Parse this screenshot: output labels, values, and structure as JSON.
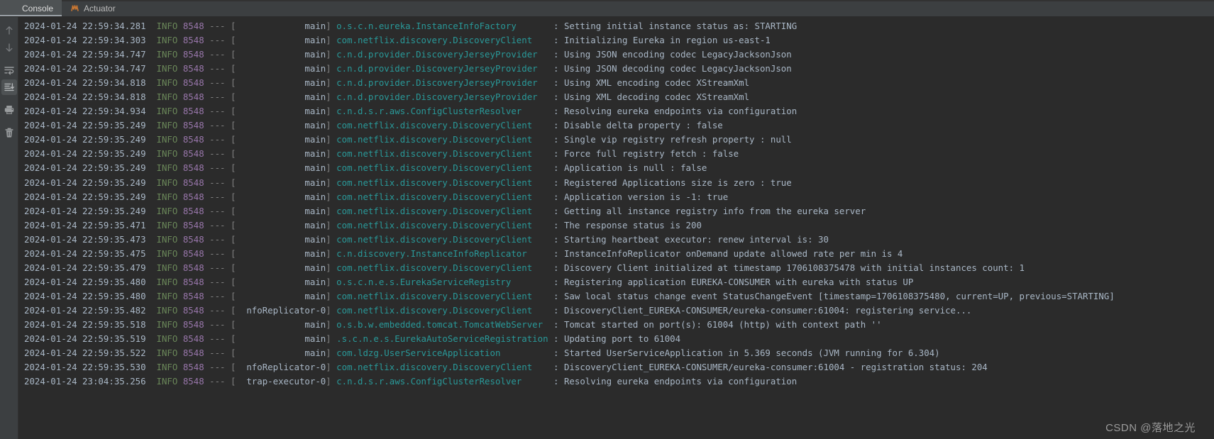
{
  "window": {
    "background_color": "#2b2b2b",
    "chrome_color": "#3c3f41"
  },
  "tabs": [
    {
      "id": "console",
      "label": "Console",
      "icon": "console-icon",
      "active": true
    },
    {
      "id": "actuator",
      "label": "Actuator",
      "icon": "actuator-icon",
      "active": false
    }
  ],
  "toolbar": {
    "buttons": [
      {
        "id": "up",
        "label": "Up",
        "icon": "arrow-up-icon",
        "selected": false
      },
      {
        "id": "down",
        "label": "Down",
        "icon": "arrow-down-icon",
        "selected": false
      },
      {
        "id": "soft-wrap",
        "label": "Soft-Wrap",
        "icon": "soft-wrap-icon",
        "selected": false
      },
      {
        "id": "scroll-end",
        "label": "Scroll to End",
        "icon": "scroll-to-end-icon",
        "selected": true
      },
      {
        "id": "print",
        "label": "Print",
        "icon": "print-icon",
        "selected": false
      },
      {
        "id": "clear-all",
        "label": "Clear All",
        "icon": "trash-icon",
        "selected": false
      }
    ]
  },
  "colors": {
    "timestamp": "#a9b7c6",
    "level": "#6a8759",
    "pid": "#9876aa",
    "separator": "#808080",
    "thread": "#a9b7c6",
    "logger": "#299999",
    "message": "#a9b7c6"
  },
  "console": {
    "lines": [
      {
        "time": "2024-01-24 22:59:34.281",
        "level": "INFO",
        "pid": "8548",
        "thread": "main",
        "logger": "o.s.c.n.eureka.InstanceInfoFactory",
        "message": "Setting initial instance status as: STARTING"
      },
      {
        "time": "2024-01-24 22:59:34.303",
        "level": "INFO",
        "pid": "8548",
        "thread": "main",
        "logger": "com.netflix.discovery.DiscoveryClient",
        "message": "Initializing Eureka in region us-east-1"
      },
      {
        "time": "2024-01-24 22:59:34.747",
        "level": "INFO",
        "pid": "8548",
        "thread": "main",
        "logger": "c.n.d.provider.DiscoveryJerseyProvider",
        "message": "Using JSON encoding codec LegacyJacksonJson"
      },
      {
        "time": "2024-01-24 22:59:34.747",
        "level": "INFO",
        "pid": "8548",
        "thread": "main",
        "logger": "c.n.d.provider.DiscoveryJerseyProvider",
        "message": "Using JSON decoding codec LegacyJacksonJson"
      },
      {
        "time": "2024-01-24 22:59:34.818",
        "level": "INFO",
        "pid": "8548",
        "thread": "main",
        "logger": "c.n.d.provider.DiscoveryJerseyProvider",
        "message": "Using XML encoding codec XStreamXml"
      },
      {
        "time": "2024-01-24 22:59:34.818",
        "level": "INFO",
        "pid": "8548",
        "thread": "main",
        "logger": "c.n.d.provider.DiscoveryJerseyProvider",
        "message": "Using XML decoding codec XStreamXml"
      },
      {
        "time": "2024-01-24 22:59:34.934",
        "level": "INFO",
        "pid": "8548",
        "thread": "main",
        "logger": "c.n.d.s.r.aws.ConfigClusterResolver",
        "message": "Resolving eureka endpoints via configuration"
      },
      {
        "time": "2024-01-24 22:59:35.249",
        "level": "INFO",
        "pid": "8548",
        "thread": "main",
        "logger": "com.netflix.discovery.DiscoveryClient",
        "message": "Disable delta property : false"
      },
      {
        "time": "2024-01-24 22:59:35.249",
        "level": "INFO",
        "pid": "8548",
        "thread": "main",
        "logger": "com.netflix.discovery.DiscoveryClient",
        "message": "Single vip registry refresh property : null"
      },
      {
        "time": "2024-01-24 22:59:35.249",
        "level": "INFO",
        "pid": "8548",
        "thread": "main",
        "logger": "com.netflix.discovery.DiscoveryClient",
        "message": "Force full registry fetch : false"
      },
      {
        "time": "2024-01-24 22:59:35.249",
        "level": "INFO",
        "pid": "8548",
        "thread": "main",
        "logger": "com.netflix.discovery.DiscoveryClient",
        "message": "Application is null : false"
      },
      {
        "time": "2024-01-24 22:59:35.249",
        "level": "INFO",
        "pid": "8548",
        "thread": "main",
        "logger": "com.netflix.discovery.DiscoveryClient",
        "message": "Registered Applications size is zero : true"
      },
      {
        "time": "2024-01-24 22:59:35.249",
        "level": "INFO",
        "pid": "8548",
        "thread": "main",
        "logger": "com.netflix.discovery.DiscoveryClient",
        "message": "Application version is -1: true"
      },
      {
        "time": "2024-01-24 22:59:35.249",
        "level": "INFO",
        "pid": "8548",
        "thread": "main",
        "logger": "com.netflix.discovery.DiscoveryClient",
        "message": "Getting all instance registry info from the eureka server"
      },
      {
        "time": "2024-01-24 22:59:35.471",
        "level": "INFO",
        "pid": "8548",
        "thread": "main",
        "logger": "com.netflix.discovery.DiscoveryClient",
        "message": "The response status is 200"
      },
      {
        "time": "2024-01-24 22:59:35.473",
        "level": "INFO",
        "pid": "8548",
        "thread": "main",
        "logger": "com.netflix.discovery.DiscoveryClient",
        "message": "Starting heartbeat executor: renew interval is: 30"
      },
      {
        "time": "2024-01-24 22:59:35.475",
        "level": "INFO",
        "pid": "8548",
        "thread": "main",
        "logger": "c.n.discovery.InstanceInfoReplicator",
        "message": "InstanceInfoReplicator onDemand update allowed rate per min is 4"
      },
      {
        "time": "2024-01-24 22:59:35.479",
        "level": "INFO",
        "pid": "8548",
        "thread": "main",
        "logger": "com.netflix.discovery.DiscoveryClient",
        "message": "Discovery Client initialized at timestamp 1706108375478 with initial instances count: 1"
      },
      {
        "time": "2024-01-24 22:59:35.480",
        "level": "INFO",
        "pid": "8548",
        "thread": "main",
        "logger": "o.s.c.n.e.s.EurekaServiceRegistry",
        "message": "Registering application EUREKA-CONSUMER with eureka with status UP"
      },
      {
        "time": "2024-01-24 22:59:35.480",
        "level": "INFO",
        "pid": "8548",
        "thread": "main",
        "logger": "com.netflix.discovery.DiscoveryClient",
        "message": "Saw local status change event StatusChangeEvent [timestamp=1706108375480, current=UP, previous=STARTING]"
      },
      {
        "time": "2024-01-24 22:59:35.482",
        "level": "INFO",
        "pid": "8548",
        "thread": "nfoReplicator-0",
        "logger": "com.netflix.discovery.DiscoveryClient",
        "message": "DiscoveryClient_EUREKA-CONSUMER/eureka-consumer:61004: registering service..."
      },
      {
        "time": "2024-01-24 22:59:35.518",
        "level": "INFO",
        "pid": "8548",
        "thread": "main",
        "logger": "o.s.b.w.embedded.tomcat.TomcatWebServer",
        "message": "Tomcat started on port(s): 61004 (http) with context path ''"
      },
      {
        "time": "2024-01-24 22:59:35.519",
        "level": "INFO",
        "pid": "8548",
        "thread": "main",
        "logger": ".s.c.n.e.s.EurekaAutoServiceRegistration",
        "message": "Updating port to 61004"
      },
      {
        "time": "2024-01-24 22:59:35.522",
        "level": "INFO",
        "pid": "8548",
        "thread": "main",
        "logger": "com.ldzg.UserServiceApplication",
        "message": "Started UserServiceApplication in 5.369 seconds (JVM running for 6.304)"
      },
      {
        "time": "2024-01-24 22:59:35.530",
        "level": "INFO",
        "pid": "8548",
        "thread": "nfoReplicator-0",
        "logger": "com.netflix.discovery.DiscoveryClient",
        "message": "DiscoveryClient_EUREKA-CONSUMER/eureka-consumer:61004 - registration status: 204"
      },
      {
        "time": "2024-01-24 23:04:35.256",
        "level": "INFO",
        "pid": "8548",
        "thread": "trap-executor-0",
        "logger": "c.n.d.s.r.aws.ConfigClusterResolver",
        "message": "Resolving eureka endpoints via configuration"
      }
    ]
  },
  "watermark": {
    "text": "CSDN @落地之光"
  }
}
